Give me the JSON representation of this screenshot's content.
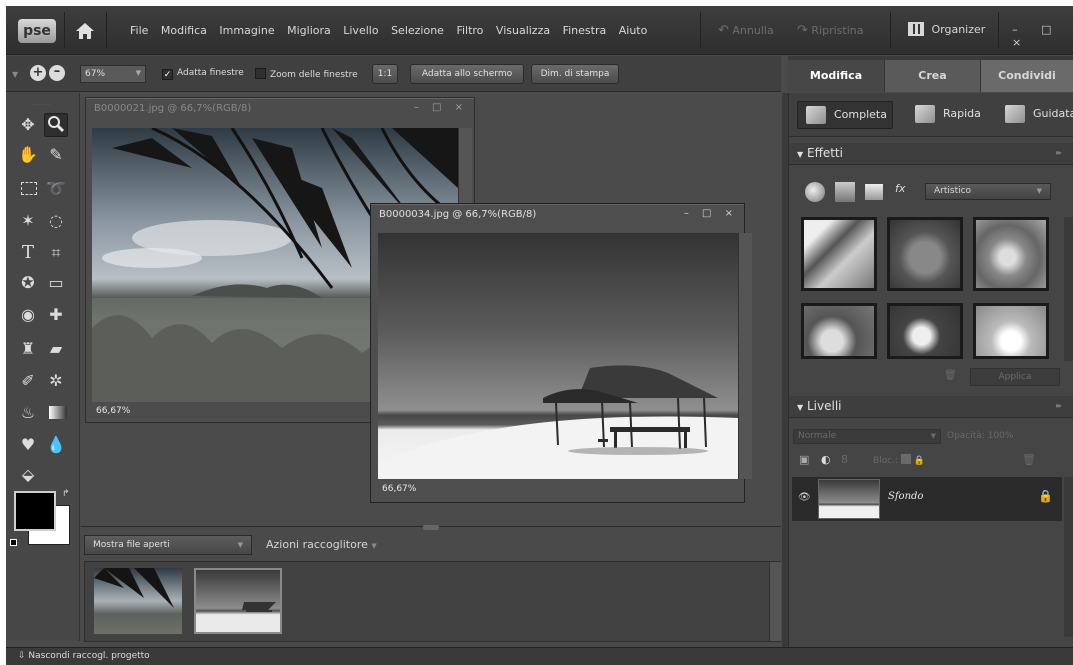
{
  "app": {
    "logo": "pse",
    "menu": [
      "File",
      "Modifica",
      "Immagine",
      "Migliora",
      "Livello",
      "Selezione",
      "Filtro",
      "Visualizza",
      "Finestra",
      "Aiuto"
    ],
    "undo_label": "Annulla",
    "redo_label": "Ripristina",
    "organizer_label": "Organizer",
    "window_controls": "– □ ×"
  },
  "options_bar": {
    "zoom_value": "67%",
    "fit_windows_label": "Adatta finestre",
    "fit_windows_checked": true,
    "zoom_windows_label": "Zoom delle finestre",
    "zoom_windows_checked": false,
    "actual_pixels_label": "1:1",
    "fit_screen_label": "Adatta allo schermo",
    "print_size_label": "Dim. di stampa"
  },
  "mode_tabs": [
    {
      "label": "Modifica",
      "active": true
    },
    {
      "label": "Crea",
      "active": false
    },
    {
      "label": "Condividi",
      "active": false
    }
  ],
  "edit_subtabs": [
    {
      "label": "Completa",
      "active": true
    },
    {
      "label": "Rapida",
      "active": false
    },
    {
      "label": "Guidata",
      "active": false
    }
  ],
  "documents": [
    {
      "title": "B0000021.jpg @ 66,7%(RGB/8)",
      "zoom": "66,67%",
      "active": false,
      "controls": "– □ ×"
    },
    {
      "title": "B0000034.jpg @ 66,7%(RGB/8)",
      "zoom": "66,67%",
      "active": true,
      "controls": "– □ ×"
    }
  ],
  "project_bin": {
    "show_label": "Mostra file aperti",
    "actions_label": "Azioni raccoglitore"
  },
  "bottom_bar": {
    "toggle_label": "Nascondi raccogl. progetto"
  },
  "effects_panel": {
    "title": "Effetti",
    "category": "Artistico",
    "apply_label": "Applica",
    "thumbnail_count": 6
  },
  "layers_panel": {
    "title": "Livelli",
    "blend_mode": "Normale",
    "opacity_label": "Opacità:",
    "opacity_value": "100%",
    "lock_label": "Bloc.:",
    "layers": [
      {
        "name": "Sfondo",
        "locked": true,
        "visible": true
      }
    ]
  },
  "colors": {
    "app_bg": "#4a4a4a",
    "panel_bg": "#454545",
    "foreground": "#000000",
    "background": "#ffffff"
  },
  "icons": [
    "home-icon",
    "undo-icon",
    "redo-icon",
    "organizer-icon",
    "zoom-in-icon",
    "zoom-out-icon",
    "move-tool-icon",
    "zoom-tool-icon",
    "hand-tool-icon",
    "eyedropper-icon",
    "marquee-icon",
    "lasso-icon",
    "magic-wand-icon",
    "selection-brush-icon",
    "type-icon",
    "crop-icon",
    "shape-icon",
    "cookie-cutter-icon",
    "red-eye-icon",
    "healing-brush-icon",
    "clone-stamp-icon",
    "eraser-icon",
    "brush-icon",
    "smart-brush-icon",
    "paint-bucket-icon",
    "gradient-icon",
    "blur-icon",
    "sponge-icon",
    "3d-icon",
    "eye-icon",
    "lock-icon",
    "trash-icon"
  ]
}
